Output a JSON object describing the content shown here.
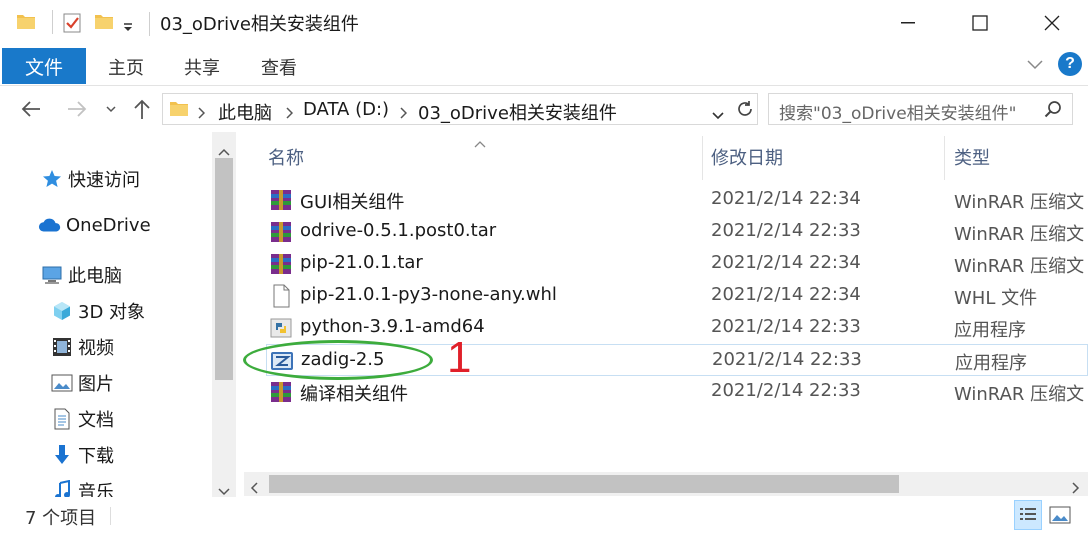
{
  "window": {
    "title": "03_oDrive相关安装组件"
  },
  "ribbon": {
    "tabs": [
      "文件",
      "主页",
      "共享",
      "查看"
    ],
    "help_label": "?"
  },
  "address_bar": {
    "crumbs": [
      "此电脑",
      "DATA (D:)",
      "03_oDrive相关安装组件"
    ]
  },
  "search": {
    "placeholder": "搜索\"03_oDrive相关安装组件\""
  },
  "nav_pane": {
    "quick_access": "快速访问",
    "onedrive": "OneDrive",
    "this_pc": "此电脑",
    "items": [
      "3D 对象",
      "视频",
      "图片",
      "文档",
      "下载",
      "音乐"
    ]
  },
  "columns": {
    "name": "名称",
    "date": "修改日期",
    "type": "类型"
  },
  "files": [
    {
      "name": "GUI相关组件",
      "date": "2021/2/14 22:34",
      "type": "WinRAR 压缩文",
      "icon": "winrar-archive-icon"
    },
    {
      "name": "odrive-0.5.1.post0.tar",
      "date": "2021/2/14 22:33",
      "type": "WinRAR 压缩文",
      "icon": "winrar-archive-icon"
    },
    {
      "name": "pip-21.0.1.tar",
      "date": "2021/2/14 22:34",
      "type": "WinRAR 压缩文",
      "icon": "winrar-archive-icon"
    },
    {
      "name": "pip-21.0.1-py3-none-any.whl",
      "date": "2021/2/14 22:34",
      "type": "WHL 文件",
      "icon": "blank-file-icon"
    },
    {
      "name": "python-3.9.1-amd64",
      "date": "2021/2/14 22:33",
      "type": "应用程序",
      "icon": "python-installer-icon"
    },
    {
      "name": "zadig-2.5",
      "date": "2021/2/14 22:33",
      "type": "应用程序",
      "icon": "zadig-app-icon"
    },
    {
      "name": "编译相关组件",
      "date": "2021/2/14 22:33",
      "type": "WinRAR 压缩文",
      "icon": "winrar-archive-icon"
    }
  ],
  "annotation": {
    "number": "1",
    "color": "#3dac3d",
    "number_color": "#e0202a"
  },
  "status": {
    "count_text": "7 个项目"
  },
  "colors": {
    "accent": "#1979ca",
    "highlight_border": "#c7dff3"
  }
}
